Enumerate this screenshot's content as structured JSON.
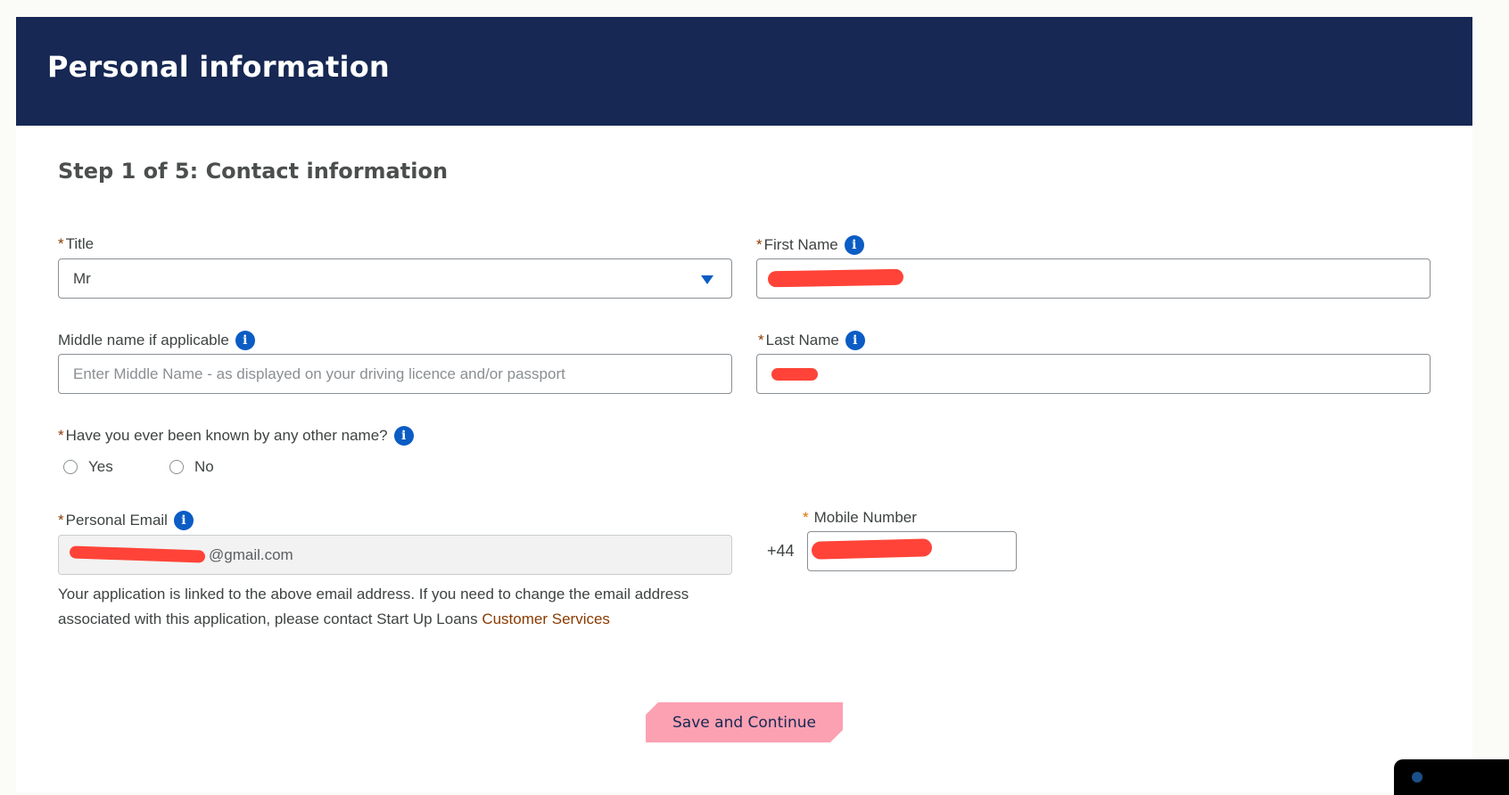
{
  "header": {
    "title": "Personal information"
  },
  "step": {
    "title": "Step 1 of 5: Contact information"
  },
  "form": {
    "required_marker": "*",
    "title": {
      "label": "Title",
      "value": "Mr",
      "icon": "chevron-down-icon"
    },
    "first_name": {
      "label": "First Name",
      "value": "",
      "redacted": true,
      "icon": "info-icon"
    },
    "middle_name": {
      "label": "Middle name if applicable",
      "placeholder": "Enter Middle Name - as displayed on your driving licence and/or passport",
      "icon": "info-icon"
    },
    "last_name": {
      "label": "Last Name",
      "value": "",
      "redacted": true,
      "icon": "info-icon"
    },
    "other_name": {
      "label": "Have you ever been known by any other name?",
      "icon": "info-icon",
      "options": [
        "Yes",
        "No"
      ],
      "selected": null
    },
    "email": {
      "label": "Personal Email",
      "value": "@gmail.com",
      "redacted_prefix": true,
      "readonly": true,
      "icon": "info-icon"
    },
    "mobile": {
      "label": "Mobile Number",
      "prefix": "+44",
      "value": "",
      "redacted": true
    },
    "help_text": "Your application is linked to the above email address. If you need to change the email address associated with this application, please contact Start Up Loans ",
    "help_link": "Customer Services",
    "info_glyph": "i"
  },
  "actions": {
    "save_label": "Save and Continue"
  },
  "colors": {
    "header_bg": "#162853",
    "accent_blue": "#0b5cc4",
    "button_bg": "#fca1b2",
    "button_text": "#162853",
    "link": "#8a3a00",
    "redaction": "#ff4338"
  }
}
